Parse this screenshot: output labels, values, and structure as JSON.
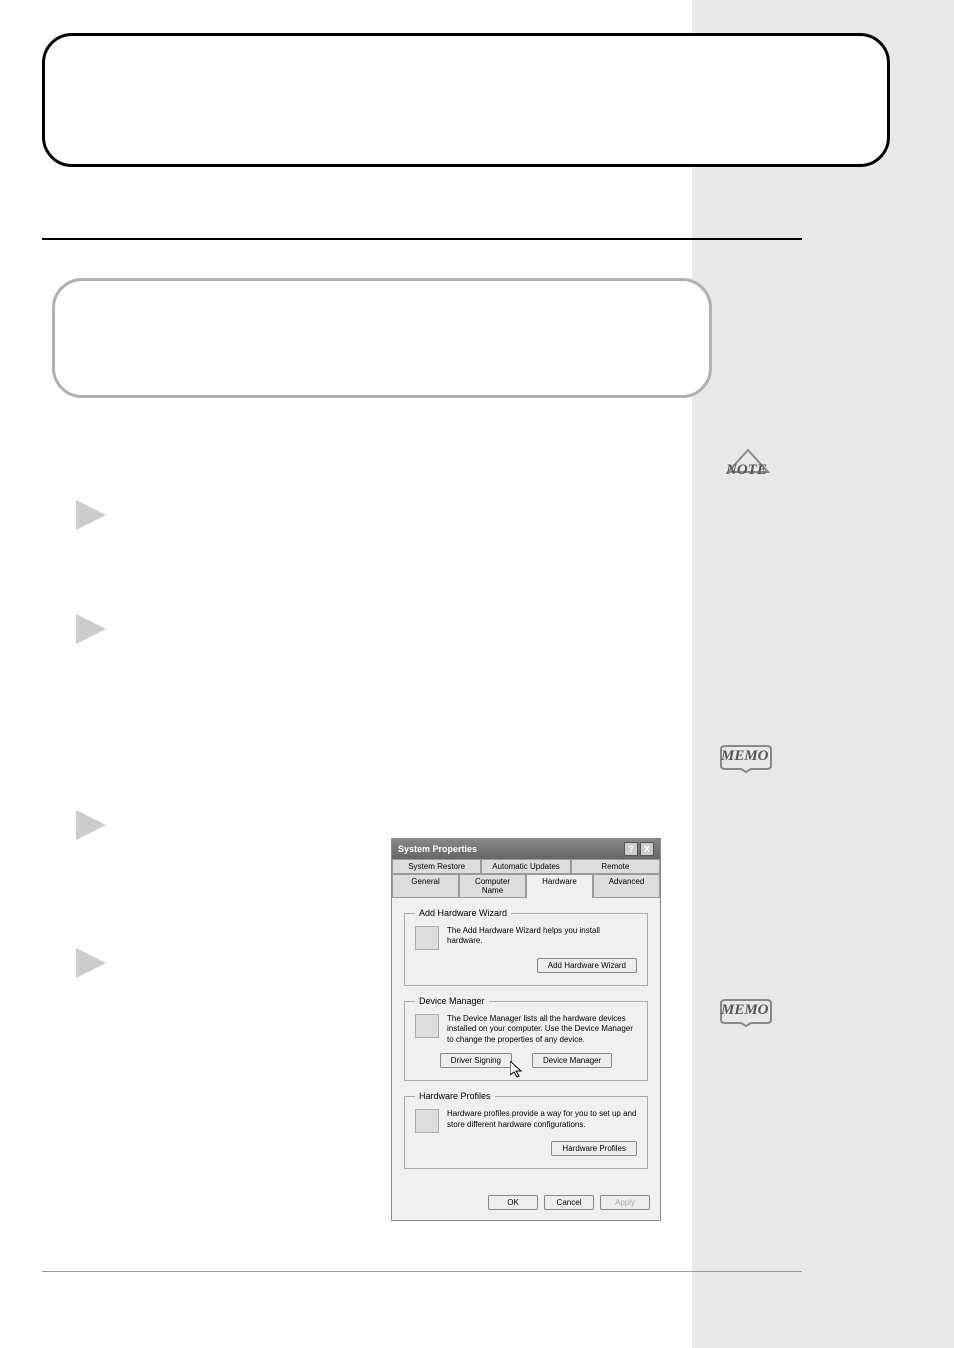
{
  "badges": {
    "note_label": "NOTE",
    "memo_label": "MEMO"
  },
  "dialog": {
    "title": "System Properties",
    "help_glyph": "?",
    "close_glyph": "X",
    "tabs_back": [
      "System Restore",
      "Automatic Updates",
      "Remote"
    ],
    "tabs_front": [
      "General",
      "Computer Name",
      "Hardware",
      "Advanced"
    ],
    "active_tab": "Hardware",
    "sections": {
      "add_hw": {
        "legend": "Add Hardware Wizard",
        "text": "The Add Hardware Wizard helps you install hardware.",
        "button": "Add Hardware Wizard"
      },
      "dev_mgr": {
        "legend": "Device Manager",
        "text": "The Device Manager lists all the hardware devices installed on your computer. Use the Device Manager to change the properties of any device.",
        "btn_left": "Driver Signing",
        "btn_right": "Device Manager"
      },
      "hw_prof": {
        "legend": "Hardware Profiles",
        "text": "Hardware profiles provide a way for you to set up and store different hardware configurations.",
        "button": "Hardware Profiles"
      }
    },
    "bottom": {
      "ok": "OK",
      "cancel": "Cancel",
      "apply": "Apply"
    }
  }
}
